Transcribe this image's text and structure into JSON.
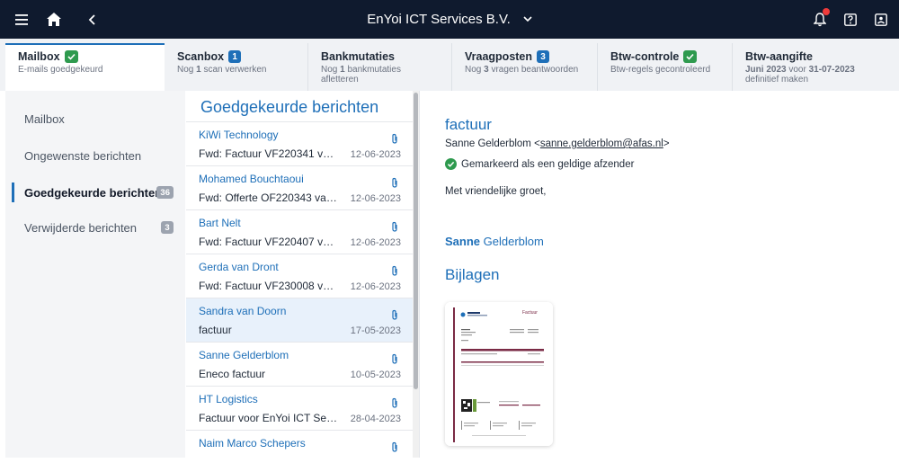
{
  "topbar": {
    "title": "EnYoi ICT Services B.V.",
    "menu_icon": "hamburger-icon",
    "home_icon": "home-icon",
    "back_icon": "chevron-left-icon",
    "dropdown_icon": "chevron-down-icon",
    "notif_icon": "bell-icon",
    "help_icon": "help-icon",
    "user_icon": "user-card-icon"
  },
  "tabs": [
    {
      "title": "Mailbox",
      "badge": "✓",
      "badge_type": "ok",
      "sub": "E-mails goedgekeurd"
    },
    {
      "title": "Scanbox",
      "badge": "1",
      "badge_type": "count",
      "sub_pre": "Nog ",
      "sub_bold": "1",
      "sub_post": " scan verwerken"
    },
    {
      "title": "Bankmutaties",
      "badge": "",
      "badge_type": "none",
      "sub_pre": "Nog ",
      "sub_bold": "1",
      "sub_post": " bankmutaties afletteren"
    },
    {
      "title": "Vraagposten",
      "badge": "3",
      "badge_type": "count",
      "sub_pre": "Nog ",
      "sub_bold": "3",
      "sub_post": " vragen beantwoorden"
    },
    {
      "title": "Btw-controle",
      "badge": "✓",
      "badge_type": "ok",
      "sub": "Btw-regels gecontroleerd"
    },
    {
      "title": "Btw-aangifte",
      "badge": "",
      "badge_type": "none",
      "sub_b1": "Juni 2023",
      "sub_mid": " voor ",
      "sub_b2": "31-07-2023",
      "sub_post": " definitief maken"
    }
  ],
  "nav": [
    {
      "label": "Mailbox",
      "count": ""
    },
    {
      "label": "Ongewenste berichten",
      "count": ""
    },
    {
      "label": "Goedgekeurde berichten",
      "count": "36"
    },
    {
      "label": "Verwijderde berichten",
      "count": "3"
    }
  ],
  "list": {
    "heading": "Goedgekeurde berichten",
    "messages": [
      {
        "from": "KiWi Technology",
        "subject": "Fwd: Factuur VF220341 van ...",
        "date": "12-06-2023"
      },
      {
        "from": "Mohamed Bouchtaoui",
        "subject": "Fwd: Offerte OF220343 van ...",
        "date": "12-06-2023"
      },
      {
        "from": "Bart Nelt",
        "subject": "Fwd: Factuur VF220407 van...",
        "date": "12-06-2023"
      },
      {
        "from": "Gerda van Dront",
        "subject": "Fwd: Factuur VF230008 van...",
        "date": "12-06-2023"
      },
      {
        "from": "Sandra van Doorn",
        "subject": "factuur",
        "date": "17-05-2023"
      },
      {
        "from": "Sanne Gelderblom",
        "subject": "Eneco factuur",
        "date": "10-05-2023"
      },
      {
        "from": "HT Logistics",
        "subject": "Factuur voor EnYoi ICT Servi...",
        "date": "28-04-2023"
      },
      {
        "from": "Naim Marco Schepers",
        "subject": "",
        "date": ""
      }
    ]
  },
  "detail": {
    "subject": "factuur",
    "from_name": "Sanne Gelderblom",
    "from_email": "sanne.gelderblom@afas.nl",
    "valid_text": "Gemarkeerd als een geldige afzender",
    "body": "Met vriendelijke groet,",
    "signature_first": "Sanne",
    "signature_last": "Gelderblom",
    "attachments_heading": "Bijlagen",
    "attachment_doc_title": "Factuur"
  },
  "colors": {
    "accent": "#1e6fb8",
    "success": "#2e9a4e",
    "topbar": "#0f1a2e",
    "alert": "#ef3b3b"
  }
}
